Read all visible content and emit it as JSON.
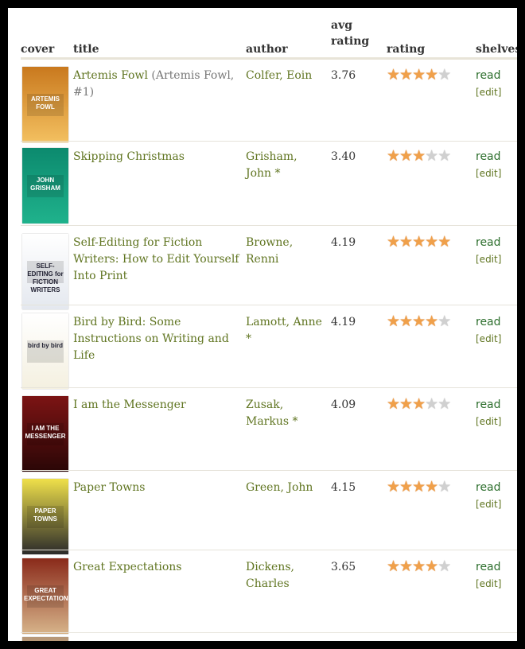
{
  "table": {
    "headers": {
      "cover": "cover",
      "title": "title",
      "author": "author",
      "avg_line1": "avg",
      "avg_line2": "rating",
      "rating": "rating",
      "shelves": "shelves"
    },
    "rows": [
      {
        "title": "Artemis Fowl",
        "series": "(Artemis Fowl, #1)",
        "author": "Colfer, Eoin",
        "avg_rating": "3.76",
        "user_rating": 4,
        "max_rating": 5,
        "shelf": "read",
        "edit": "[edit]",
        "cover_text": "ARTEMIS FOWL",
        "cover_colors": [
          "#c9791e",
          "#f3c060"
        ]
      },
      {
        "title": "Skipping Christmas",
        "series": "",
        "author": "Grisham, John *",
        "avg_rating": "3.40",
        "user_rating": 3,
        "max_rating": 5,
        "shelf": "read",
        "edit": "[edit]",
        "cover_text": "JOHN GRISHAM",
        "cover_colors": [
          "#0c8a6e",
          "#1fb28c"
        ]
      },
      {
        "title": "Self-Editing for Fiction Writers: How to Edit Yourself Into Print",
        "series": "",
        "author": "Browne, Renni",
        "avg_rating": "4.19",
        "user_rating": 5,
        "max_rating": 5,
        "shelf": "read",
        "edit": "[edit]",
        "cover_text": "SELF-EDITING for FICTION WRITERS",
        "cover_colors": [
          "#ffffff",
          "#e4e8ef"
        ]
      },
      {
        "title": "Bird by Bird: Some Instructions on Writing and Life",
        "series": "",
        "author": "Lamott, Anne *",
        "avg_rating": "4.19",
        "user_rating": 4,
        "max_rating": 5,
        "shelf": "read",
        "edit": "[edit]",
        "cover_text": "bird by bird",
        "cover_colors": [
          "#ffffff",
          "#f4f0e0"
        ]
      },
      {
        "title": "I am the Messenger",
        "series": "",
        "author": "Zusak, Markus *",
        "avg_rating": "4.09",
        "user_rating": 3,
        "max_rating": 5,
        "shelf": "read",
        "edit": "[edit]",
        "cover_text": "I AM THE MESSENGER",
        "cover_colors": [
          "#7c1414",
          "#2a0606"
        ]
      },
      {
        "title": "Paper Towns",
        "series": "",
        "author": "Green, John",
        "avg_rating": "4.15",
        "user_rating": 4,
        "max_rating": 5,
        "shelf": "read",
        "edit": "[edit]",
        "cover_text": "PAPER TOWNS",
        "cover_colors": [
          "#efe04a",
          "#2a2a2a"
        ]
      },
      {
        "title": "Great Expectations",
        "series": "",
        "author": "Dickens, Charles",
        "avg_rating": "3.65",
        "user_rating": 4,
        "max_rating": 5,
        "shelf": "read",
        "edit": "[edit]",
        "cover_text": "GREAT EXPECTATIONS",
        "cover_colors": [
          "#8a2a1a",
          "#d7b48a"
        ]
      }
    ]
  }
}
